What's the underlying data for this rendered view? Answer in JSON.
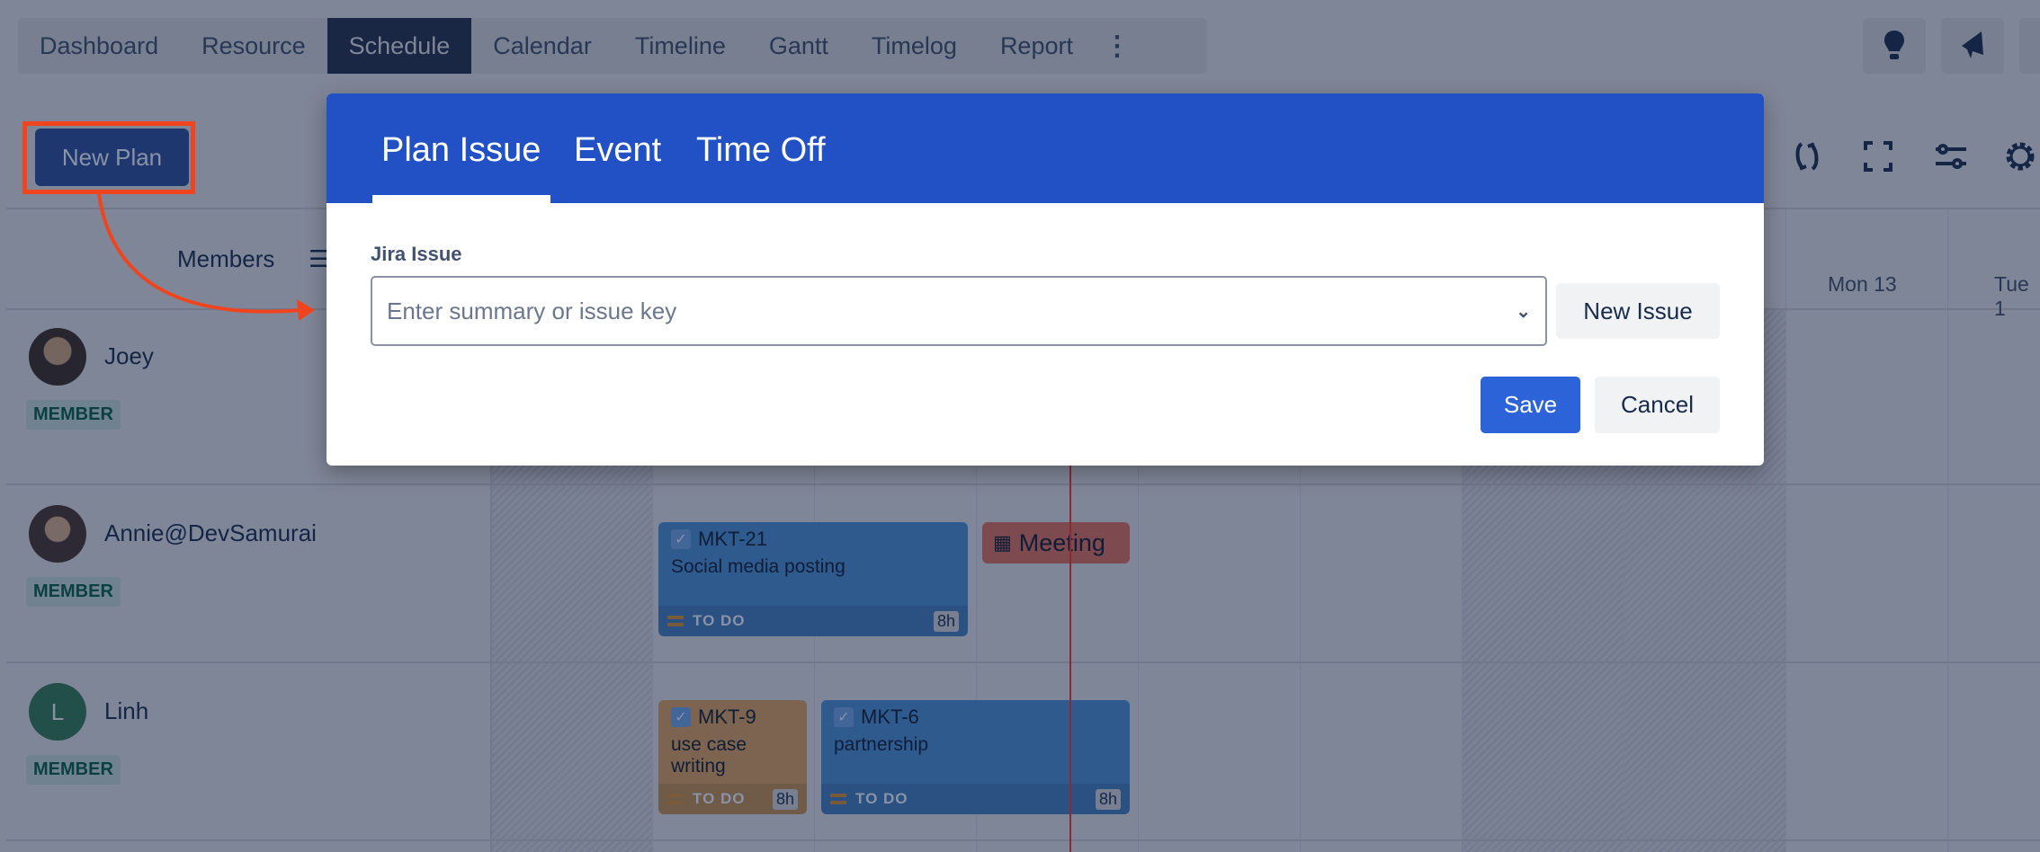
{
  "nav": {
    "tabs": [
      "Dashboard",
      "Resource",
      "Schedule",
      "Calendar",
      "Timeline",
      "Gantt",
      "Timelog",
      "Report"
    ],
    "active": "Schedule"
  },
  "toolbar": {
    "new_plan": "New Plan"
  },
  "grid": {
    "members_header": "Members",
    "days": [
      "Mon 13",
      "Tue 1"
    ],
    "members": [
      {
        "name": "Joey",
        "role": "MEMBER"
      },
      {
        "name": "Annie@DevSamurai",
        "role": "MEMBER"
      },
      {
        "name": "Linh",
        "role": "MEMBER",
        "initial": "L"
      }
    ],
    "cards": [
      {
        "key": "MKT-21",
        "summary": "Social media posting",
        "status": "TO DO",
        "hours": "8h",
        "color": "#4c9aff"
      },
      {
        "key": "MKT-9",
        "summary": "use case writing",
        "status": "TO DO",
        "hours": "8h",
        "color": "#f8b565"
      },
      {
        "key": "MKT-6",
        "summary": "partnership",
        "status": "TO DO",
        "hours": "8h",
        "color": "#4c9aff"
      }
    ],
    "event": {
      "label": "Meeting",
      "color": "#fa7d65"
    }
  },
  "dialog": {
    "tabs": [
      "Plan Issue",
      "Event",
      "Time Off"
    ],
    "active_tab": "Plan Issue",
    "field_label": "Jira Issue",
    "placeholder": "Enter summary or issue key",
    "new_issue": "New Issue",
    "save": "Save",
    "cancel": "Cancel"
  },
  "colors": {
    "header": "#2251c5",
    "primary": "#2d63d8",
    "annotation": "#f0441e"
  }
}
